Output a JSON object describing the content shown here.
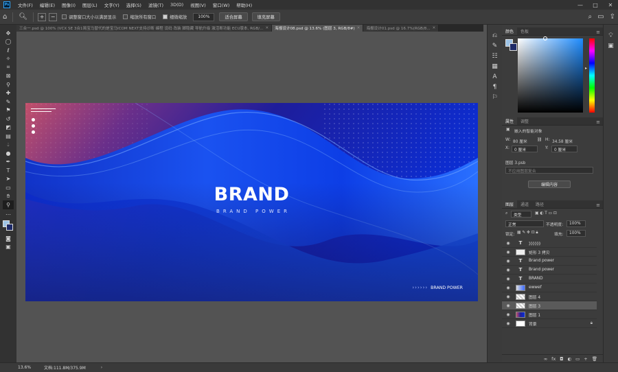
{
  "menubar": {
    "logo": "Ps",
    "items": [
      "文件(F)",
      "编辑(E)",
      "图像(I)",
      "图层(L)",
      "文字(Y)",
      "选择(S)",
      "滤镜(T)",
      "3D(D)",
      "视图(V)",
      "窗口(W)",
      "帮助(H)"
    ],
    "controls": [
      "—",
      "□",
      "✕"
    ]
  },
  "options": {
    "resize_windows": "调整窗口大小以满屏显示",
    "zoom_all": "缩放所有窗口",
    "scrubby_zoom": "细微缩放",
    "zoom_value": "100%",
    "fit_screen": "适合屏幕",
    "fill_screen": "填充屏幕"
  },
  "tabs": [
    {
      "label": "三合一.psd @ 100% (VCX SE 3合1简宝马替代的是宝马ICOM NEXT支持诊断 编程 设码 改装 脚隐藏 导航升级 激活断功能 ECU版本, RGB/..."
    },
    {
      "label": "海报设计08.psd @ 13.6% (图层 3, RGB/8#)",
      "active": true
    },
    {
      "label": "海报设计01.psd @ 16.7%(RGB/8..."
    }
  ],
  "artwork": {
    "title": "BRAND",
    "subtitle": "BRAND POWER",
    "footer_chevrons": "››››››",
    "footer_text": "BRAND POWER"
  },
  "status": {
    "zoom": "13.6%",
    "doc": "文档:111.8M/375.9M",
    "arrow": "›"
  },
  "color_panel": {
    "tabs": [
      "颜色",
      "色板"
    ],
    "fg": "#9dc3e6",
    "bg": "#1d2a68"
  },
  "properties": {
    "tabs": [
      "属性",
      "调整"
    ],
    "object_type": "嵌入的智能对象",
    "w_label": "W:",
    "w_value": "80 厘米",
    "h_label": "H:",
    "h_value": "34.58 厘米",
    "x_label": "X:",
    "x_value": "0 厘米",
    "y_label": "Y:",
    "y_value": "0 厘米",
    "layer_name": "图层 3.psb",
    "no_comps": "不应用图层复合",
    "edit_button": "编辑内容"
  },
  "layers_panel": {
    "tabs": [
      "图层",
      "通道",
      "路径"
    ],
    "filter_label": "类型",
    "blend_mode": "正常",
    "opacity_label": "不透明度:",
    "opacity_value": "100%",
    "lock_label": "锁定:",
    "fill_label": "填充:",
    "fill_value": "100%",
    "layers": [
      {
        "name": "》》》》》》",
        "kind": "text"
      },
      {
        "name": "矩形 3 拷贝",
        "kind": "shape"
      },
      {
        "name": "Brand power",
        "kind": "text"
      },
      {
        "name": "Brand power",
        "kind": "text"
      },
      {
        "name": "BRAND",
        "kind": "text"
      },
      {
        "name": "ewwef",
        "kind": "smart"
      },
      {
        "name": "图层 4",
        "kind": "smart"
      },
      {
        "name": "图层 3",
        "kind": "smart",
        "selected": true
      },
      {
        "name": "图层 1",
        "kind": "image"
      },
      {
        "name": "背景",
        "kind": "background",
        "locked": true
      }
    ],
    "footer_icons": [
      "∞",
      "fx",
      "◘",
      "◐",
      "▭",
      "+",
      "🗑"
    ]
  }
}
